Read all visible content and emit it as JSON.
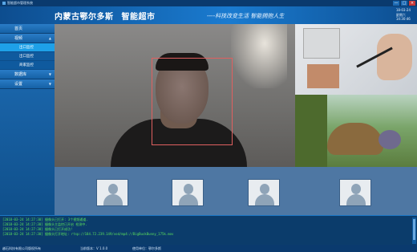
{
  "titlebar": {
    "title": "智能超市管理系统",
    "minimize": "—",
    "maximize": "□",
    "close": "×"
  },
  "header": {
    "brand_1": "内蒙古鄂尔多斯",
    "brand_2": "智能超市",
    "slogan": "----科技改变生活  智能拥抱人生",
    "date": "18-03-24",
    "weekday": "星期六",
    "time": "14:30:46"
  },
  "sidebar": {
    "items": [
      {
        "label": "首页"
      },
      {
        "label": "视频",
        "arrow": "▲"
      },
      {
        "label": "数据库",
        "arrow": "▼"
      },
      {
        "label": "设置",
        "arrow": "▼"
      }
    ],
    "sub_items": [
      {
        "label": "出口监控"
      },
      {
        "label": "出口监控"
      },
      {
        "label": "商家监控"
      }
    ]
  },
  "log": {
    "lines": [
      "[2018-03-24 14:27:30] 摄像头已打开: 3个视频通道.",
      "[2018-03-24 14:27:30] 摄像头主监控已开启 检测中.",
      "[2018-03-24 14:27:30] 摄像头已打开成功!",
      "[2018-03-24 14:27:30] 摄像头打开地址: rtsp://184.72.239.149/vod/mp4://BigBuckBunny_175k.mov"
    ]
  },
  "status": {
    "company": "越石科技有限公司版权所有",
    "version": "当前版本：V 1.0.0",
    "unit": "使用单位：鄂尔多斯"
  },
  "colors": {
    "header_bg": "#1a7bd0",
    "sidebar_active": "#1ea0e8",
    "log_text": "#5be05b",
    "face_box": "#e06060"
  }
}
